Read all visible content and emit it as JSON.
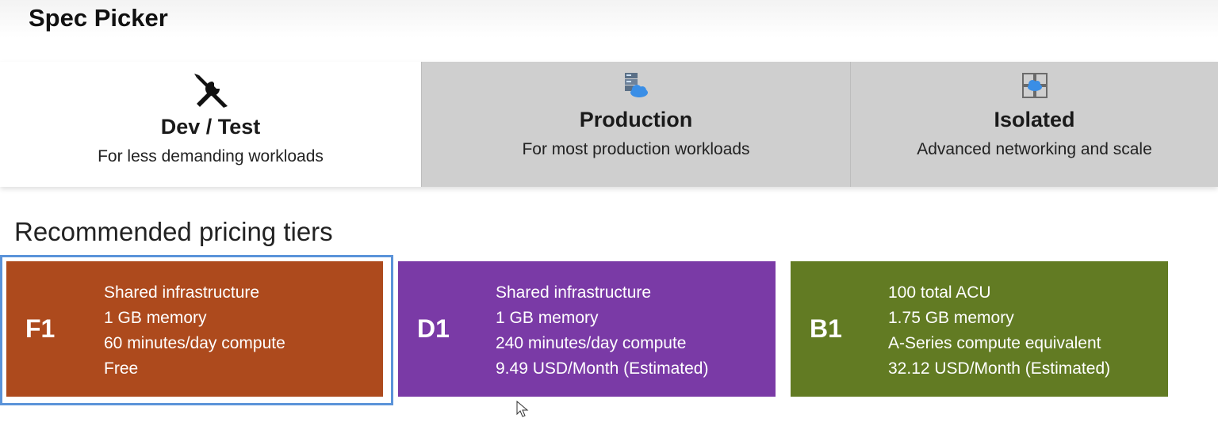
{
  "app_title": "Spec Picker",
  "tabs": [
    {
      "label": "Dev / Test",
      "description": "For less demanding workloads",
      "icon": "tools-icon",
      "selected": true
    },
    {
      "label": "Production",
      "description": "For most production workloads",
      "icon": "server-cloud-icon",
      "selected": false
    },
    {
      "label": "Isolated",
      "description": "Advanced networking and scale",
      "icon": "isolated-cloud-icon",
      "selected": false
    }
  ],
  "section_title": "Recommended pricing tiers",
  "tiers": [
    {
      "code": "F1",
      "color": "#ad4a1d",
      "focused": true,
      "lines": [
        "Shared infrastructure",
        "1 GB memory",
        "60 minutes/day compute",
        "Free"
      ]
    },
    {
      "code": "D1",
      "color": "#7a3aa6",
      "lines": [
        "Shared infrastructure",
        "1 GB memory",
        "240 minutes/day compute",
        "9.49 USD/Month (Estimated)"
      ]
    },
    {
      "code": "B1",
      "color": "#627b23",
      "lines": [
        "100 total ACU",
        "1.75 GB memory",
        "A-Series compute equivalent",
        "32.12 USD/Month (Estimated)"
      ]
    }
  ],
  "colors": {
    "focus_border": "#5b93d9",
    "tab_unselected_bg": "#cfcfcf"
  }
}
